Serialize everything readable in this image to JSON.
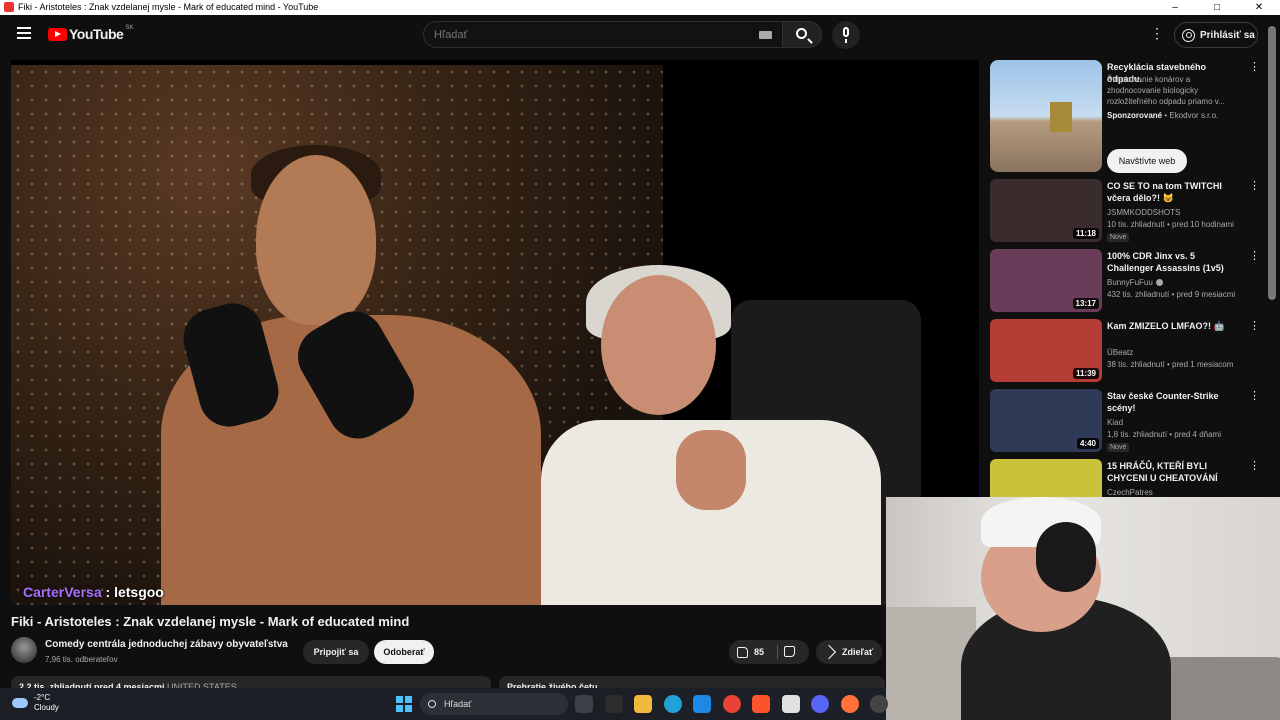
{
  "window": {
    "title": "Fiki - Aristoteles : Znak vzdelanej mysle - Mark of educated mind - YouTube"
  },
  "header": {
    "logo_text": "YouTube",
    "region": "SK",
    "search_placeholder": "Hľadať",
    "more_icon": "⋮",
    "signin_label": "Prihlásiť sa"
  },
  "player": {
    "chat_user": "CarterVersa",
    "chat_message": " : letsgoo"
  },
  "video": {
    "title": "Fiki - Aristoteles : Znak vzdelanej mysle - Mark of educated mind",
    "channel": "Comedy centrála jednoduchej zábavy obyvateľstva",
    "subscribers": "7,96 tis. odberateľov",
    "join_label": "Pripojiť sa",
    "subscribe_label": "Odoberať",
    "likes": "85",
    "share_label": "Zdieľať",
    "description_meta": "2,2 tis. zhliadnutí  pred 4 mesiacmi",
    "description_location": "  UNITED STATES",
    "live_chat_label": "Prehratie živého četu"
  },
  "sidebar": {
    "ad": {
      "title": "Recyklácia stavebného odpadu.",
      "desc": "Štiepkovanie konárov a zhodnocovanie biologicky rozložiteľného odpadu priamo v...",
      "sponsored_label": "Sponzorované",
      "advertiser": " • Ekodvor s.r.o.",
      "cta": "Navštívte web"
    },
    "items": [
      {
        "title": "CO SE TO na tom TWITCHI včera dělo?! 😺",
        "channel": "JSMMKODDSHOTS",
        "meta": "10 tis. zhliadnutí • pred 10 hodinami",
        "duration": "11:18",
        "badge": "Nové"
      },
      {
        "title": "100% CDR Jinx vs. 5 Challenger Assassins (1v5)",
        "channel": "BunnyFuFuu",
        "meta": "432 tis. zhliadnutí • pred 9 mesiacmi",
        "duration": "13:17",
        "badge": ""
      },
      {
        "title": "Kam ZMIZELO LMFAO?! 🤖",
        "channel": "ÜBeatz",
        "meta": "38 tis. zhliadnutí • pred 1 mesiacom",
        "duration": "11:39",
        "badge": ""
      },
      {
        "title": "Stav české Counter-Strike scény!",
        "channel": "Kiad",
        "meta": "1,8 tis. zhliadnutí • pred 4 dňami",
        "duration": "4:40",
        "badge": "Nové"
      },
      {
        "title": "15 HRÁČŮ, KTEŘÍ BYLI CHYCENI U CHEATOVÁNÍ",
        "channel": "CzechPatres",
        "meta": "",
        "duration": "",
        "badge": ""
      }
    ],
    "thumb_colors": [
      "#3a2c2c",
      "#6a3c5a",
      "#b53b35",
      "#2e3a56",
      "#c9c23a"
    ]
  },
  "taskbar": {
    "temperature": "-2°C",
    "weather": "Cloudy",
    "search_label": "Hľadať"
  },
  "colors": {
    "youtube_red": "#ff0000",
    "chat_user": "#a970ff",
    "windows_blue": "#4cc2ff"
  }
}
